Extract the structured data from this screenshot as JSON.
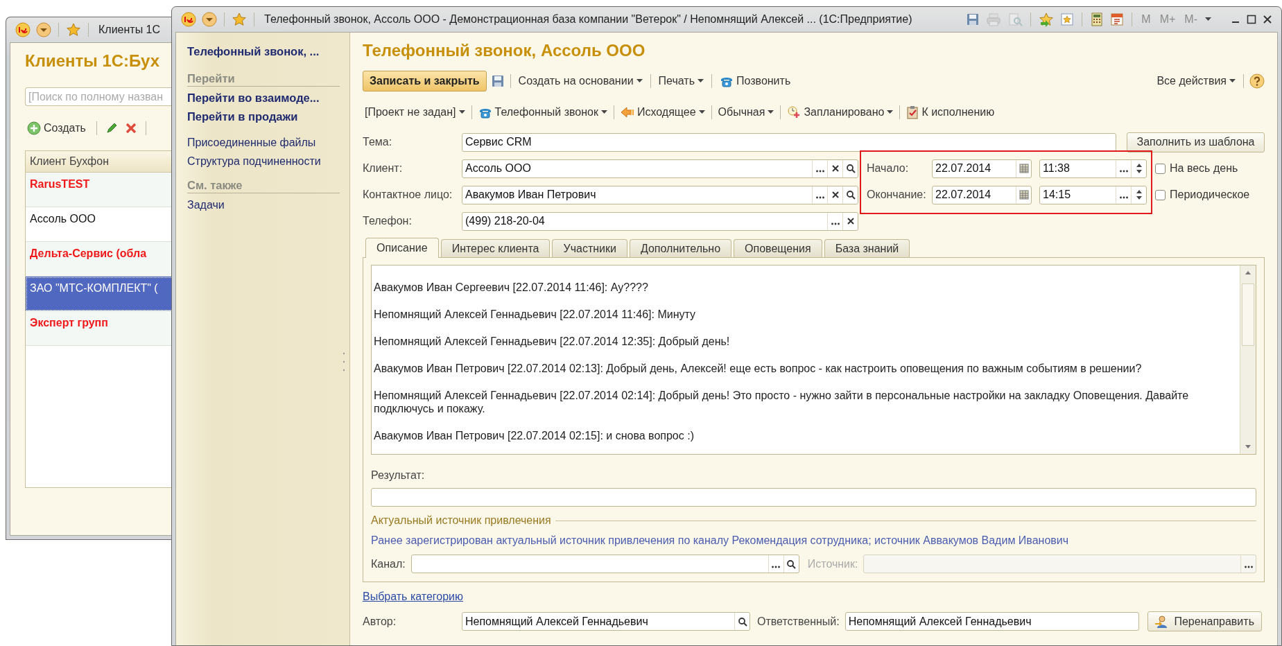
{
  "back_window": {
    "title": "Клиенты 1С",
    "heading": "Клиенты 1С:Бух",
    "search": {
      "placeholder": "[Поиск по полному назван"
    },
    "create_button": "Создать",
    "table": {
      "columns": [
        "Клиент Бухфон"
      ],
      "rows": [
        {
          "name": "RarusTEST",
          "highlighted": true,
          "selected": false
        },
        {
          "name": "Ассоль ООО",
          "highlighted": false,
          "selected": false
        },
        {
          "name": "Дельта-Сервис (обла",
          "highlighted": true,
          "selected": false
        },
        {
          "name": "ЗАО \"МТС-КОМПЛЕКТ\" (",
          "highlighted": false,
          "selected": true
        },
        {
          "name": "Эксперт групп",
          "highlighted": true,
          "selected": false
        }
      ]
    }
  },
  "window": {
    "title": "Телефонный звонок, Ассоль ООО - Демонстрационная база компании \"Ветерок\" / Непомнящий Алексей ...  (1С:Предприятие)",
    "memory_buttons": [
      {
        "label": "M",
        "disabled": true
      },
      {
        "label": "M+",
        "disabled": true
      },
      {
        "label": "M-",
        "disabled": true
      }
    ]
  },
  "sidebar": {
    "title": "Телефонный звонок, ...",
    "sections": [
      {
        "heading": "Перейти",
        "items": [
          {
            "label": "Перейти во взаимоде...",
            "bold": true
          },
          {
            "label": "Перейти в продажи",
            "bold": true
          },
          {
            "label": "Присоединенные файлы",
            "bold": false
          },
          {
            "label": "Структура подчиненности",
            "bold": false
          }
        ]
      },
      {
        "heading": "См. также",
        "items": [
          {
            "label": "Задачи",
            "bold": false
          }
        ]
      }
    ]
  },
  "form": {
    "title": "Телефонный звонок, Ассоль ООО",
    "save_close_button": "Записать и закрыть",
    "toolbar": [
      {
        "label": "Создать на основании",
        "dropdown": true
      },
      {
        "label": "Печать",
        "dropdown": true
      },
      {
        "label": "Позвонить",
        "dropdown": false
      }
    ],
    "all_actions": "Все действия",
    "toolbar2": [
      {
        "label": "[Проект не задан]",
        "dropdown": true
      },
      {
        "label": "Телефонный звонок",
        "dropdown": true
      },
      {
        "label": "Исходящее",
        "dropdown": true
      },
      {
        "label": "Обычная",
        "dropdown": true
      },
      {
        "label": "Запланировано",
        "dropdown": true
      },
      {
        "label": "К исполнению",
        "dropdown": false
      }
    ],
    "subject": {
      "label": "Тема:",
      "value": "Сервис CRM"
    },
    "fill_template_button": "Заполнить из шаблона",
    "client": {
      "label": "Клиент:",
      "value": "Ассоль ООО"
    },
    "contact": {
      "label": "Контактное лицо:",
      "value": "Авакумов Иван Петрович"
    },
    "phone": {
      "label": "Телефон:",
      "value": "(499) 218-20-04"
    },
    "start": {
      "label": "Начало:",
      "date": "22.07.2014",
      "time": "11:38"
    },
    "end": {
      "label": "Окончание:",
      "date": "22.07.2014",
      "time": "14:15"
    },
    "all_day": {
      "label": "На весь день",
      "checked": false
    },
    "periodic": {
      "label": "Периодическое",
      "checked": false
    },
    "tabs": [
      {
        "label": "Описание",
        "selected": true
      },
      {
        "label": "Интерес клиента",
        "selected": false
      },
      {
        "label": "Участники",
        "selected": false
      },
      {
        "label": "Дополнительно",
        "selected": false
      },
      {
        "label": "Оповещения",
        "selected": false
      },
      {
        "label": "База знаний",
        "selected": false
      }
    ],
    "description": [
      "Авакумов Иван Сергеевич [22.07.2014 11:46]: Ау????",
      "Непомнящий Алексей Геннадьевич [22.07.2014 11:46]: Минуту",
      "Непомнящий Алексей Геннадьевич [22.07.2014 12:35]: Добрый день!",
      "Авакумов Иван Петрович [22.07.2014 02:13]: Добрый день, Алексей! еще есть вопрос - как настроить оповещения по важным событиям в решении?",
      "Непомнящий Алексей Геннадьевич [22.07.2014 02:14]: Добрый день! Это просто - нужно зайти в персональные настройки на закладку Оповещения. Давайте подключусь и покажу.",
      "Авакумов Иван Петрович [22.07.2014 02:15]: и снова вопрос :)"
    ],
    "result_label": "Результат:",
    "source_group": {
      "title": "Актуальный источник привлечения",
      "note": "Ранее зарегистрирован актуальный источник привлечения по каналу Рекомендация сотрудника; источник Аввакумов Вадим Иванович",
      "channel_label": "Канал:",
      "source": {
        "label": "Источник:",
        "disabled": true
      }
    },
    "category_link": "Выбрать категорию",
    "author": {
      "label": "Автор:",
      "value": "Непомнящий Алексей Геннадьевич"
    },
    "responsible": {
      "label": "Ответственный:",
      "value": "Непомнящий Алексей Геннадьевич"
    },
    "redirect_button": "Перенаправить"
  }
}
